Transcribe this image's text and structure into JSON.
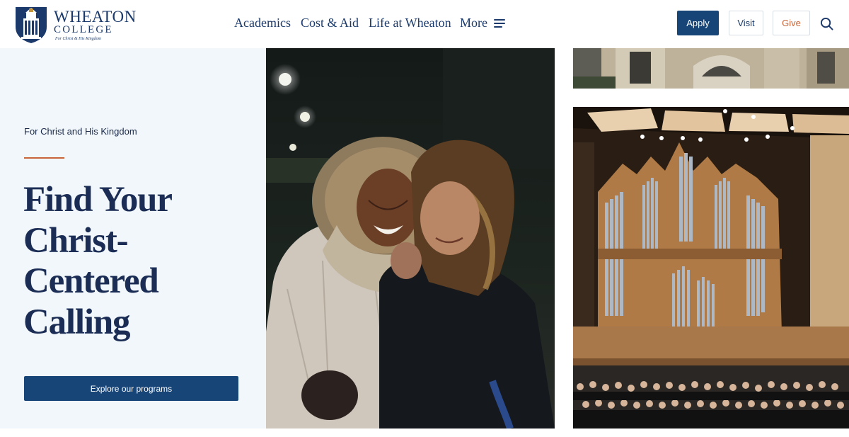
{
  "header": {
    "logo": {
      "name": "WHEATON",
      "sub": "COLLEGE",
      "motto": "For Christ & His Kingdom"
    },
    "nav": [
      {
        "label": "Academics"
      },
      {
        "label": "Cost & Aid"
      },
      {
        "label": "Life at Wheaton"
      },
      {
        "label": "More"
      }
    ],
    "buttons": {
      "apply": "Apply",
      "visit": "Visit",
      "give": "Give"
    }
  },
  "hero": {
    "eyebrow": "For Christ and His Kingdom",
    "headline": "Find Your Christ-Centered Calling",
    "cta": "Explore our programs"
  },
  "colors": {
    "brand_blue": "#174578",
    "accent_orange": "#c8653a",
    "hero_bg": "#f1f7fb"
  }
}
